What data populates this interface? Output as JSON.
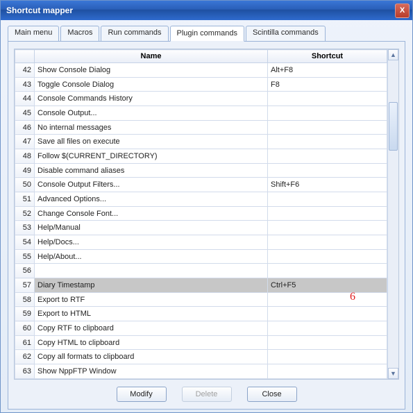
{
  "window": {
    "title": "Shortcut mapper"
  },
  "tabs": [
    {
      "label": "Main menu",
      "active": false
    },
    {
      "label": "Macros",
      "active": false
    },
    {
      "label": "Run commands",
      "active": false
    },
    {
      "label": "Plugin commands",
      "active": true
    },
    {
      "label": "Scintilla commands",
      "active": false
    }
  ],
  "columns": {
    "name": "Name",
    "shortcut": "Shortcut"
  },
  "rows": [
    {
      "idx": 42,
      "name": "Show Console Dialog",
      "shortcut": "Alt+F8"
    },
    {
      "idx": 43,
      "name": "Toggle Console Dialog",
      "shortcut": "F8"
    },
    {
      "idx": 44,
      "name": "Console Commands History",
      "shortcut": ""
    },
    {
      "idx": 45,
      "name": "Console Output...",
      "shortcut": ""
    },
    {
      "idx": 46,
      "name": "No internal messages",
      "shortcut": ""
    },
    {
      "idx": 47,
      "name": "Save all files on execute",
      "shortcut": ""
    },
    {
      "idx": 48,
      "name": "Follow $(CURRENT_DIRECTORY)",
      "shortcut": ""
    },
    {
      "idx": 49,
      "name": "Disable command aliases",
      "shortcut": ""
    },
    {
      "idx": 50,
      "name": "Console Output Filters...",
      "shortcut": "Shift+F6"
    },
    {
      "idx": 51,
      "name": "Advanced Options...",
      "shortcut": ""
    },
    {
      "idx": 52,
      "name": "Change Console Font...",
      "shortcut": ""
    },
    {
      "idx": 53,
      "name": "Help/Manual",
      "shortcut": ""
    },
    {
      "idx": 54,
      "name": "Help/Docs...",
      "shortcut": ""
    },
    {
      "idx": 55,
      "name": "Help/About...",
      "shortcut": ""
    },
    {
      "idx": 56,
      "name": "",
      "shortcut": ""
    },
    {
      "idx": 57,
      "name": "Diary Timestamp",
      "shortcut": "Ctrl+F5",
      "selected": true
    },
    {
      "idx": 58,
      "name": "Export to RTF",
      "shortcut": ""
    },
    {
      "idx": 59,
      "name": "Export to HTML",
      "shortcut": ""
    },
    {
      "idx": 60,
      "name": "Copy RTF to clipboard",
      "shortcut": ""
    },
    {
      "idx": 61,
      "name": "Copy HTML to clipboard",
      "shortcut": ""
    },
    {
      "idx": 62,
      "name": "Copy all formats to clipboard",
      "shortcut": ""
    },
    {
      "idx": 63,
      "name": "Show NppFTP Window",
      "shortcut": ""
    }
  ],
  "annotation": {
    "text": "6"
  },
  "buttons": {
    "modify": "Modify",
    "delete": "Delete",
    "close": "Close"
  },
  "closeX": "X"
}
